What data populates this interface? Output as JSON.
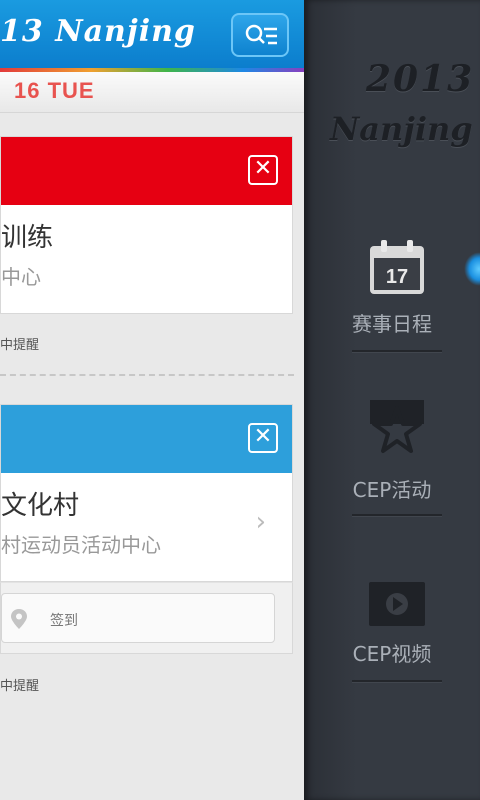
{
  "header": {
    "logo_text": "13 Nanjing",
    "menu_icon": "search-list-icon"
  },
  "date_bar": {
    "date": "16 TUE"
  },
  "events": [
    {
      "header_color": "#e60012",
      "title": "训练",
      "location": "中心",
      "reminder": "中提醒"
    },
    {
      "header_color": "#2d9fdb",
      "title": "文化村",
      "location": "村运动员活动中心",
      "checkin_label": "签到",
      "reminder": "中提醒"
    }
  ],
  "drawer": {
    "logo_year": "2013",
    "logo_city": "Nanjing",
    "items": [
      {
        "label": "赛事日程",
        "icon": "calendar-icon",
        "icon_text": "17",
        "active": true
      },
      {
        "label": "CEP活动",
        "icon": "star-icon"
      },
      {
        "label": "CEP视频",
        "icon": "video-play-icon"
      }
    ]
  },
  "colors": {
    "brand_blue": "#1a9be0",
    "red": "#e60012",
    "drawer_bg": "#353a42",
    "date_red": "#e8534f"
  }
}
